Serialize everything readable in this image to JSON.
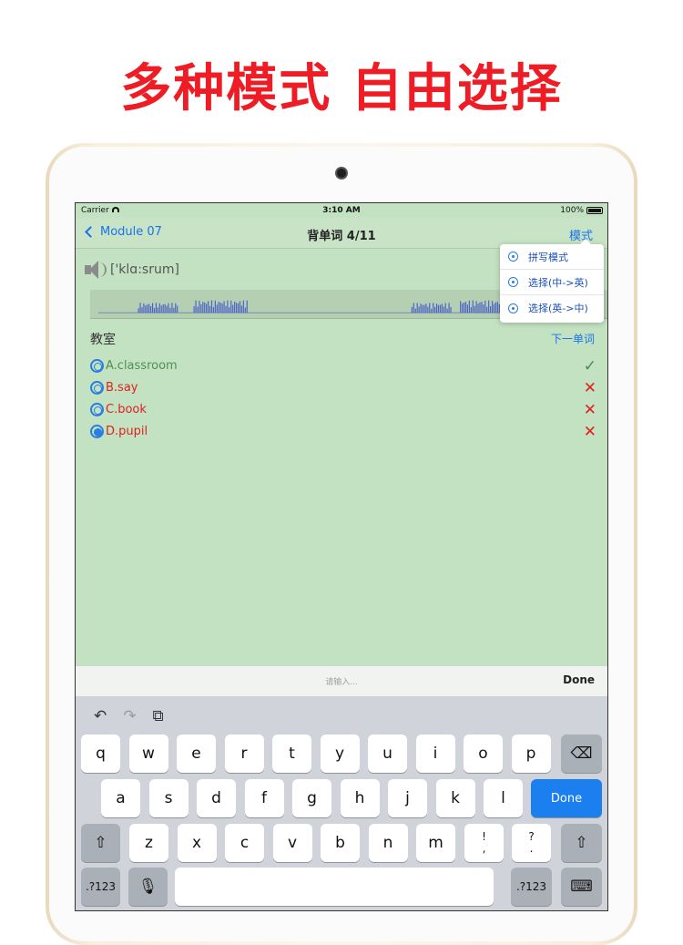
{
  "headline": "多种模式 自由选择",
  "status": {
    "carrier": "Carrier",
    "time": "3:10 AM",
    "battery": "100%"
  },
  "nav": {
    "back": "Module 07",
    "title": "背单词  4/11",
    "mode": "模式"
  },
  "word": {
    "phonetic": "['klɑ:srum]",
    "meaning": "教室",
    "next": "下一单词"
  },
  "options": [
    {
      "label": "A.classroom",
      "color": "#4f8f57",
      "mark": "✓",
      "state": "correct"
    },
    {
      "label": "B.say",
      "color": "#e0201e",
      "mark": "✕",
      "state": "wrong"
    },
    {
      "label": "C.book",
      "color": "#e0201e",
      "mark": "✕",
      "state": "wrong"
    },
    {
      "label": "D.pupil",
      "color": "#e0201e",
      "mark": "✕",
      "state": "wrong",
      "selected": true
    }
  ],
  "mode_menu": [
    "拼写模式",
    "选择(中->英)",
    "选择(英->中)"
  ],
  "input": {
    "placeholder": "请输入...",
    "done": "Done"
  },
  "keyboard": {
    "tools": [
      "↶",
      "↷",
      "⧉"
    ],
    "row1": [
      "q",
      "w",
      "e",
      "r",
      "t",
      "y",
      "u",
      "i",
      "o",
      "p"
    ],
    "row2": [
      "a",
      "s",
      "d",
      "f",
      "g",
      "h",
      "j",
      "k",
      "l"
    ],
    "row3": [
      "z",
      "x",
      "c",
      "v",
      "b",
      "n",
      "m"
    ],
    "punct1": [
      "!",
      ","
    ],
    "punct2": [
      "?",
      "."
    ],
    "done": "Done",
    "numbers": ".?123",
    "backspace": "⌫",
    "shift": "⇧",
    "mic": "🎙",
    "hide": "⌨"
  },
  "colors": {
    "accent": "#1a73e8",
    "headline": "#ee1c24",
    "screen_bg": "#c3e2c2",
    "correct": "#4f8f57",
    "wrong": "#e0201e"
  }
}
